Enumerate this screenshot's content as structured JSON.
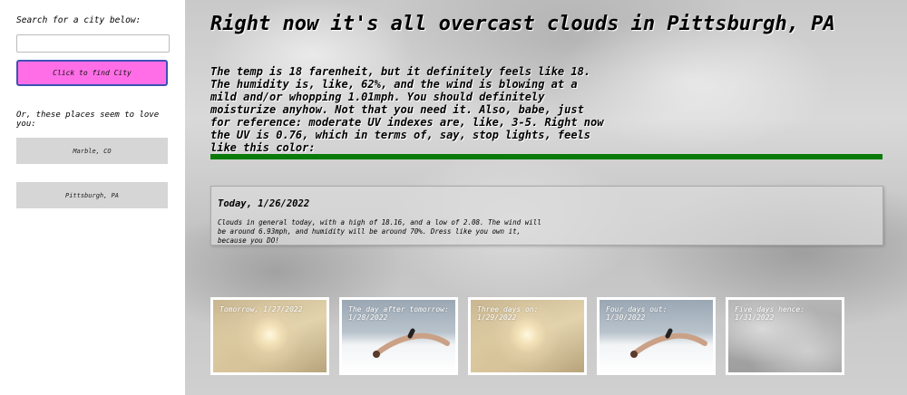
{
  "sidebar": {
    "search_label": "Search for a city below:",
    "search_value": "",
    "find_button": "Click to find City",
    "favorites_label": "Or, these places seem to love you:",
    "cities": [
      "Marble, CO",
      "Pittsburgh, PA"
    ],
    "accent_color": "#ff6ee6"
  },
  "current": {
    "headline": "Right now it's all overcast clouds in Pittsburgh, PA",
    "details": "The temp is 18 farenheit, but it definitely feels like 18. The humidity is, like, 62%, and the wind is blowing at a mild and/or whopping 1.01mph. You should definitely moisturize anyhow. Not that you need it. Also, babe, just for reference: moderate UV indexes are, like, 3-5. Right now the UV is 0.76, which in terms of, say, stop lights, feels like this color:",
    "uv_color": "#0a7a0a"
  },
  "today": {
    "title": "Today, 1/26/2022",
    "description": "Clouds in general today, with a high of 18.16, and a low of 2.08. The wind will be around 6.93mph, and humidity will be around 70%. Dress like you own it, because you DO!"
  },
  "forecast": [
    {
      "label": "Tomorrow, 1/27/2022",
      "image": "sun-haze"
    },
    {
      "label": "The day after tomorrow: 1/28/2022",
      "image": "snow-dive"
    },
    {
      "label": "Three days on: 1/29/2022",
      "image": "sun-haze"
    },
    {
      "label": "Four days out: 1/30/2022",
      "image": "snow-dive"
    },
    {
      "label": "Five days hence: 1/31/2022",
      "image": "clouds"
    }
  ]
}
